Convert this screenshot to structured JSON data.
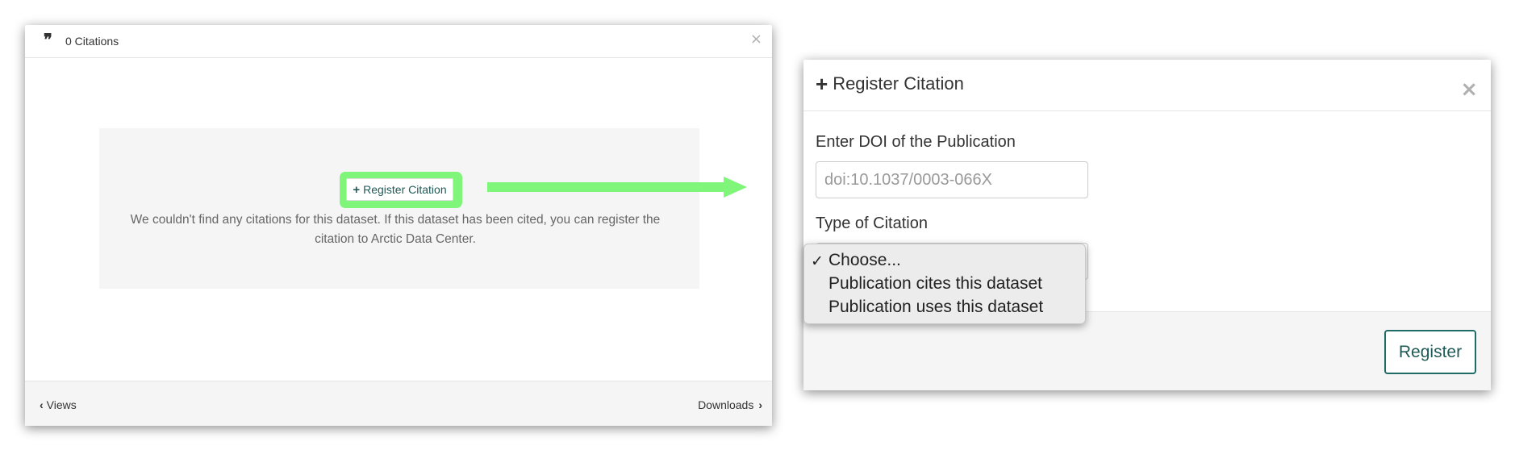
{
  "left_modal": {
    "title": "0 Citations",
    "close": "×",
    "register_button": "Register Citation",
    "message_line1": "We couldn't find any citations for this dataset. If this dataset has been cited, you can register the",
    "message_line2": "citation to Arctic Data Center.",
    "footer_left": "Views",
    "footer_right": "Downloads"
  },
  "right_modal": {
    "title": "Register Citation",
    "close": "×",
    "doi_label": "Enter DOI of the Publication",
    "doi_placeholder": "doi:10.1037/0003-066X",
    "type_label": "Type of Citation",
    "register_button": "Register"
  },
  "dropdown": {
    "options": [
      "Choose...",
      "Publication cites this dataset",
      "Publication uses this dataset"
    ],
    "selected": "Choose..."
  },
  "colors": {
    "highlight": "#7ff57a",
    "accent_teal": "#1f5a56"
  }
}
